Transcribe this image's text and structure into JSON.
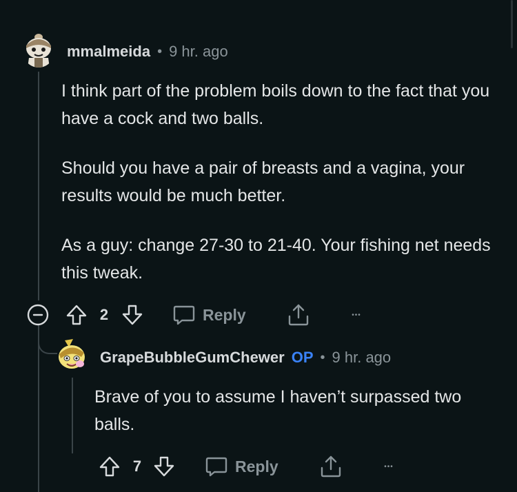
{
  "comments": [
    {
      "author": "mmalmeida",
      "separator": "•",
      "time": "9 hr. ago",
      "paragraphs": [
        "I think part of the problem boils down to the fact that you have a cock and two balls.",
        "Should you have a pair of breasts and a vagina, your results would be much better.",
        "As a guy: change 27-30 to 21-40. Your fishing net needs this tweak."
      ],
      "votes": "2",
      "reply_label": "Reply",
      "more_label": "•••"
    },
    {
      "author": "GrapeBubbleGumChewer",
      "op_badge": "OP",
      "separator": "•",
      "time": "9 hr. ago",
      "paragraphs": [
        "Brave of you to assume I haven’t surpassed two balls."
      ],
      "votes": "7",
      "reply_label": "Reply",
      "more_label": "•••"
    }
  ],
  "icons": {
    "collapse": "minus-circle-icon",
    "upvote": "arrow-up-icon",
    "downvote": "arrow-down-icon",
    "reply": "speech-bubble-icon",
    "share": "share-icon",
    "more": "ellipsis-icon"
  },
  "colors": {
    "background": "#0b1416",
    "op_badge": "#3a82f7",
    "meta_text": "#8a9499",
    "thread_line": "#3a4448"
  }
}
